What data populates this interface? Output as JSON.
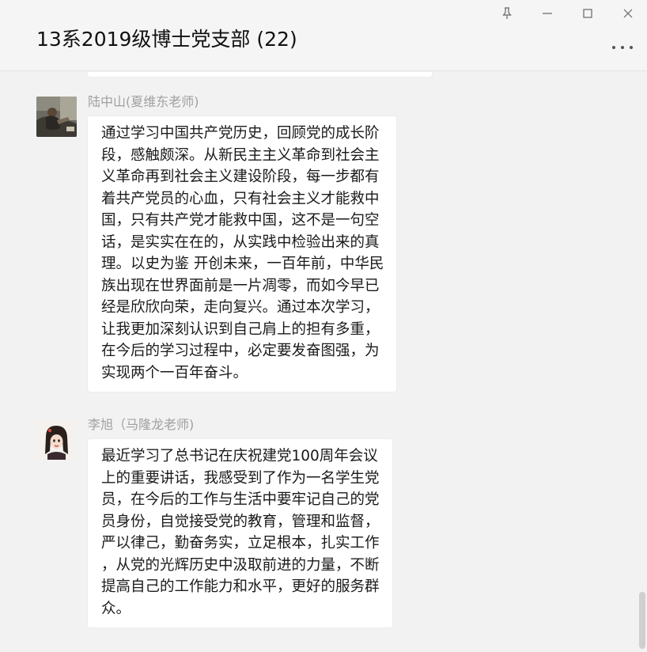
{
  "window": {
    "title": "13系2019级博士党支部 (22)"
  },
  "messages": [
    {
      "sender": "陆中山(夏维东老师)",
      "lines": [
        "通过学习中国共产党历史，回顾党的成长阶",
        "段，感触颇深。从新民主主义革命到社会主",
        "义革命再到社会主义建设阶段，每一步都有",
        "着共产党员的心血，只有社会主义才能救中",
        "国，只有共产党才能救中国，这不是一句空",
        "话，是实实在在的，从实践中检验出来的真",
        "理。以史为鉴 开创未来，一百年前，中华民",
        "族出现在世界面前是一片凋零，而如今早已",
        "经是欣欣向荣，走向复兴。通过本次学习，",
        "让我更加深刻认识到自己肩上的担有多重，",
        "在今后的学习过程中，必定要发奋图强，为",
        "实现两个一百年奋斗。"
      ]
    },
    {
      "sender": "李旭（马隆龙老师)",
      "lines": [
        "最近学习了总书记在庆祝建党100周年会议",
        "上的重要讲话，我感受到了作为一名学生党",
        "员，在今后的工作与生活中要牢记自己的党",
        "员身份，自觉接受党的教育，管理和监督，",
        "严以律己，勤奋务实，立足根本，扎实工作",
        "，从党的光辉历史中汲取前进的力量，不断",
        "提高自己的工作能力和水平，更好的服务群",
        "众。"
      ]
    }
  ],
  "icons": {
    "pin": "pin-icon",
    "minimize": "minimize-icon",
    "maximize": "maximize-icon",
    "close": "close-icon",
    "more": "more-icon"
  },
  "colors": {
    "background": "#f2f2f2",
    "bubble": "#ffffff",
    "sender_name": "#a0a0a0"
  }
}
